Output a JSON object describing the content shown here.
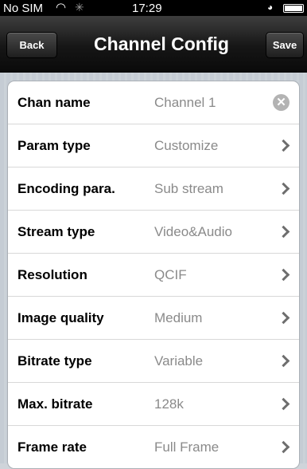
{
  "status_bar": {
    "carrier": "No SIM",
    "time": "17:29"
  },
  "nav": {
    "back_label": "Back",
    "title": "Channel Config",
    "save_label": "Save"
  },
  "rows": [
    {
      "label": "Chan name",
      "value": "Channel 1",
      "accessory": "clear-icon"
    },
    {
      "label": "Param type",
      "value": "Customize",
      "accessory": "chevron-right-icon"
    },
    {
      "label": "Encoding para.",
      "value": "Sub stream",
      "accessory": "chevron-right-icon"
    },
    {
      "label": "Stream type",
      "value": "Video&Audio",
      "accessory": "chevron-right-icon"
    },
    {
      "label": "Resolution",
      "value": "QCIF",
      "accessory": "chevron-right-icon"
    },
    {
      "label": "Image quality",
      "value": "Medium",
      "accessory": "chevron-right-icon"
    },
    {
      "label": "Bitrate type",
      "value": "Variable",
      "accessory": "chevron-right-icon"
    },
    {
      "label": "Max. bitrate",
      "value": "128k",
      "accessory": "chevron-right-icon"
    },
    {
      "label": "Frame rate",
      "value": "Full Frame",
      "accessory": "chevron-right-icon"
    }
  ]
}
